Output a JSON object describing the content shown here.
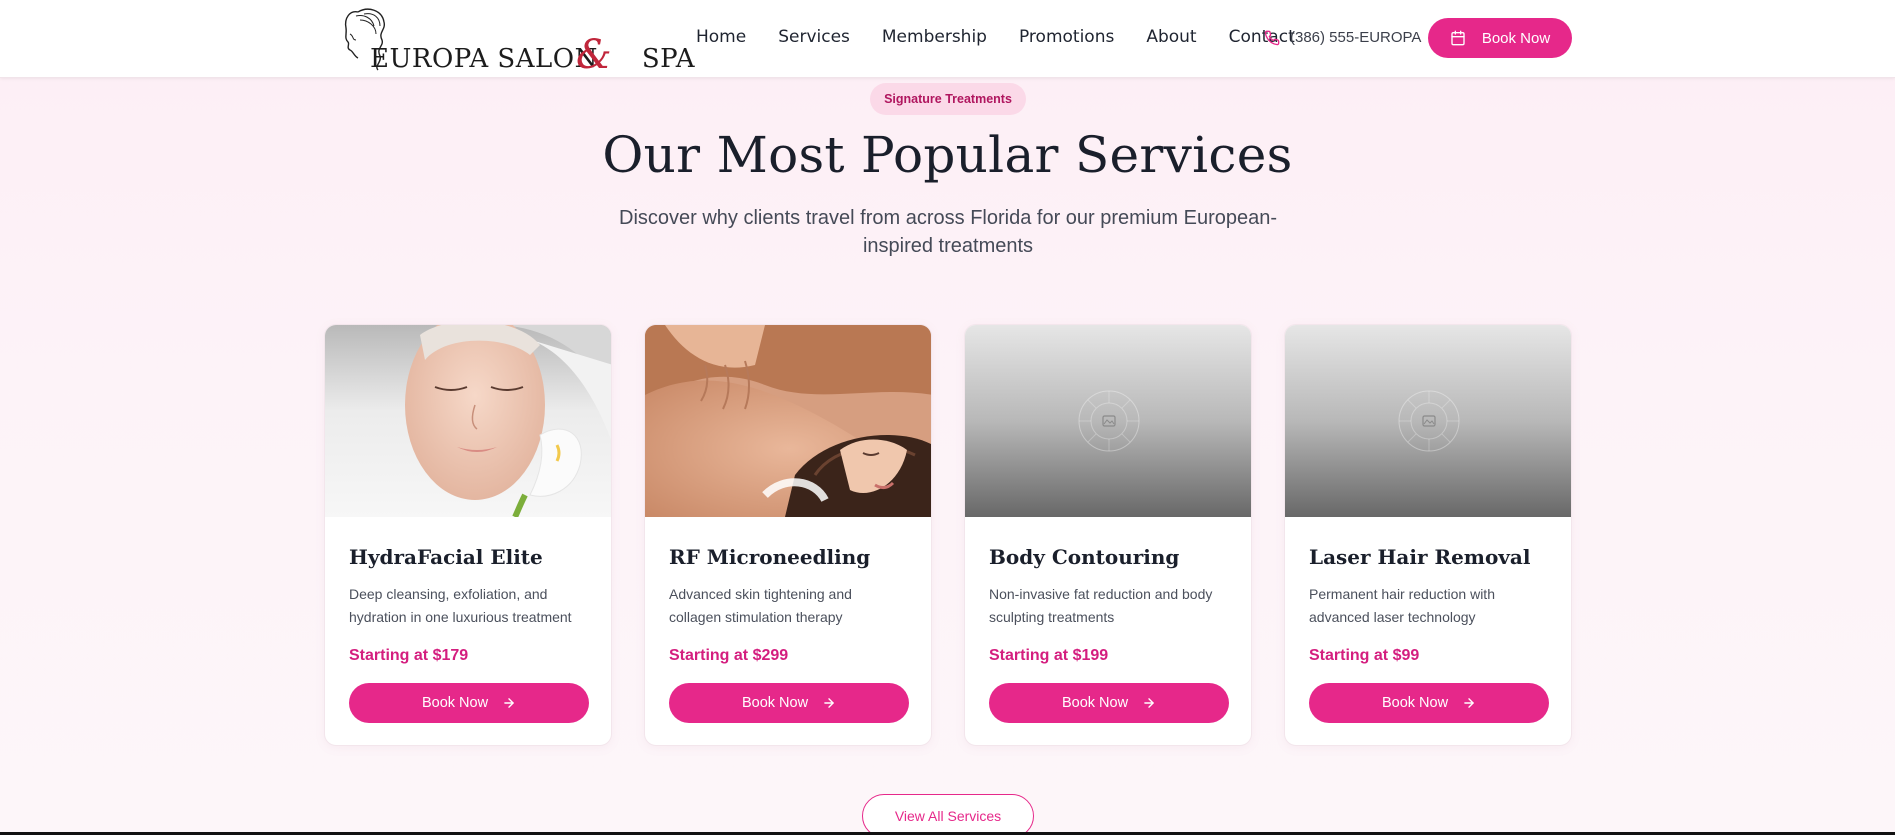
{
  "header": {
    "logo": {
      "text": "EUROPA SALON",
      "ampersand": "&",
      "text_end": "SPA"
    },
    "nav": [
      "Home",
      "Services",
      "Membership",
      "Promotions",
      "About",
      "Contact"
    ],
    "phone": "(386) 555-EUROPA",
    "book_label": "Book Now"
  },
  "section": {
    "badge": "Signature Treatments",
    "title": "Our Most Popular Services",
    "subtitle": "Discover why clients travel from across Florida for our premium European-inspired treatments"
  },
  "cards": [
    {
      "title": "HydraFacial Elite",
      "desc": "Deep cleansing, exfoliation, and hydration in one luxurious treatment",
      "price": "Starting at $179",
      "button": "Book Now",
      "image": "facial-photo"
    },
    {
      "title": "RF Microneedling",
      "desc": "Advanced skin tightening and collagen stimulation therapy",
      "price": "Starting at $299",
      "button": "Book Now",
      "image": "massage-photo"
    },
    {
      "title": "Body Contouring",
      "desc": "Non-invasive fat reduction and body sculpting treatments",
      "price": "Starting at $199",
      "button": "Book Now",
      "image": "placeholder"
    },
    {
      "title": "Laser Hair Removal",
      "desc": "Permanent hair reduction with advanced laser technology",
      "price": "Starting at $99",
      "button": "Book Now",
      "image": "placeholder"
    }
  ],
  "view_all": "View All Services",
  "colors": {
    "accent": "#e6288a",
    "price": "#d41e7f",
    "badge_bg": "#fbd9e8"
  },
  "icons": {
    "phone": "phone-icon",
    "calendar": "calendar-icon",
    "arrow": "arrow-right-icon",
    "image": "image-placeholder-icon"
  }
}
